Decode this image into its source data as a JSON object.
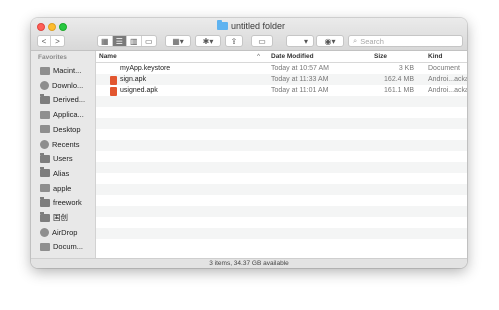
{
  "window": {
    "title": "untitled folder"
  },
  "toolbar": {
    "back": "<",
    "forward": ">",
    "search_placeholder": "Search"
  },
  "sidebar": {
    "section": "Favorites",
    "items": [
      {
        "label": "Macint...",
        "icon": "hard-drive-icon"
      },
      {
        "label": "Downlo...",
        "icon": "download-icon"
      },
      {
        "label": "Derived...",
        "icon": "folder-icon"
      },
      {
        "label": "Applica...",
        "icon": "applications-icon"
      },
      {
        "label": "Desktop",
        "icon": "desktop-icon"
      },
      {
        "label": "Recents",
        "icon": "recents-icon"
      },
      {
        "label": "Users",
        "icon": "folder-icon"
      },
      {
        "label": "Alias",
        "icon": "folder-icon"
      },
      {
        "label": "apple",
        "icon": "home-icon"
      },
      {
        "label": "freework",
        "icon": "folder-icon"
      },
      {
        "label": "国创",
        "icon": "folder-icon"
      },
      {
        "label": "AirDrop",
        "icon": "airdrop-icon"
      },
      {
        "label": "Docum...",
        "icon": "documents-icon"
      }
    ]
  },
  "columns": {
    "name": "Name",
    "date": "Date Modified",
    "size": "Size",
    "kind": "Kind"
  },
  "files": [
    {
      "name": "myApp.keystore",
      "date": "Today at 10:57 AM",
      "size": "3 KB",
      "kind": "Document",
      "icon": "document-icon"
    },
    {
      "name": "sign.apk",
      "date": "Today at 11:33 AM",
      "size": "162.4 MB",
      "kind": "Androi...ackage",
      "icon": "apk-icon"
    },
    {
      "name": "usigned.apk",
      "date": "Today at 11:01 AM",
      "size": "161.1 MB",
      "kind": "Androi...ackage",
      "icon": "apk-icon"
    }
  ],
  "status": "3 items, 34.37 GB available"
}
